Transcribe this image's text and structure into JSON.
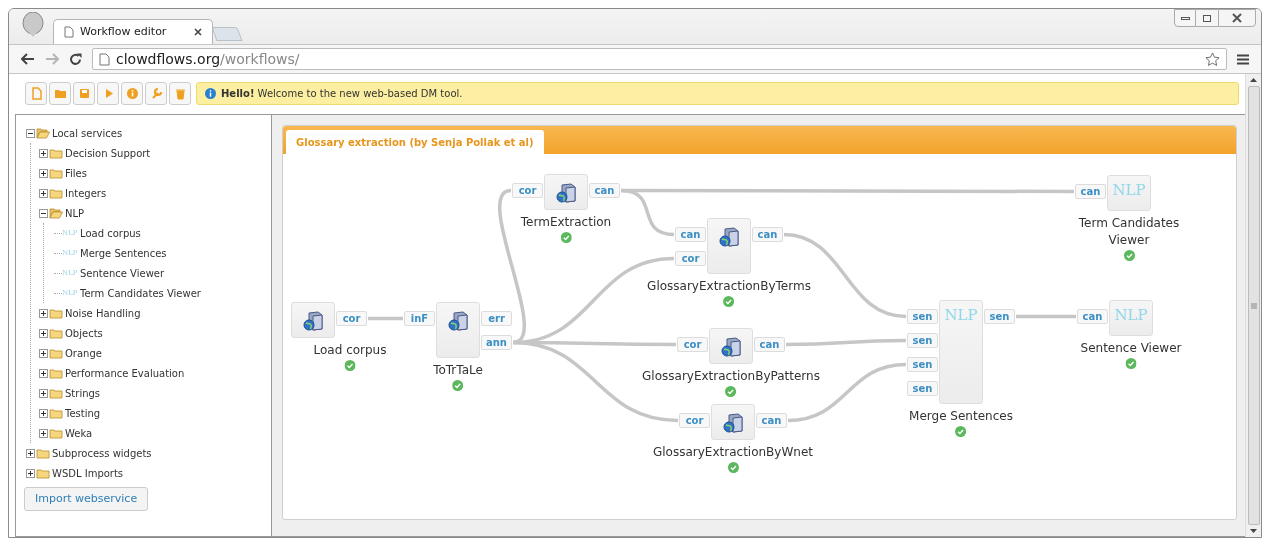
{
  "browser": {
    "tab_title": "Workflow editor",
    "url_host": "clowdflows.org",
    "url_path": "/workflows/"
  },
  "toolbar": {
    "buttons": [
      {
        "kind": "new"
      },
      {
        "kind": "open"
      },
      {
        "kind": "save"
      },
      {
        "kind": "run"
      },
      {
        "kind": "info"
      },
      {
        "kind": "settings"
      },
      {
        "kind": "delete"
      }
    ]
  },
  "alert": {
    "text": "**Hello!** Welcome to the new web-based DM tool."
  },
  "sidebar": {
    "tree": [
      {
        "label": "Local services",
        "kind": "category",
        "expanded": true,
        "children": [
          {
            "label": "Decision Support",
            "kind": "category",
            "expanded": false
          },
          {
            "label": "Files",
            "kind": "category",
            "expanded": false
          },
          {
            "label": "Integers",
            "kind": "category",
            "expanded": false
          },
          {
            "label": "NLP",
            "kind": "category",
            "expanded": true,
            "children": [
              {
                "label": "Load corpus",
                "kind": "widget",
                "icon_text": "NLP"
              },
              {
                "label": "Merge Sentences",
                "kind": "widget",
                "icon_text": "NLP"
              },
              {
                "label": "Sentence Viewer",
                "kind": "widget",
                "icon_text": "NLP"
              },
              {
                "label": "Term Candidates Viewer",
                "kind": "widget",
                "icon_text": "NLP"
              }
            ]
          },
          {
            "label": "Noise Handling",
            "kind": "category",
            "expanded": false
          },
          {
            "label": "Objects",
            "kind": "category",
            "expanded": false
          },
          {
            "label": "Orange",
            "kind": "category",
            "expanded": false
          },
          {
            "label": "Performance Evaluation",
            "kind": "category",
            "expanded": false
          },
          {
            "label": "Strings",
            "kind": "category",
            "expanded": false
          },
          {
            "label": "Testing",
            "kind": "category",
            "expanded": false
          },
          {
            "label": "Weka",
            "kind": "category",
            "expanded": false
          }
        ]
      },
      {
        "label": "Subprocess widgets",
        "kind": "category",
        "expanded": false
      },
      {
        "label": "WSDL Imports",
        "kind": "category",
        "expanded": false
      }
    ],
    "button": "Import webservice"
  },
  "workflow": {
    "title": "Glossary extraction (by Senja Pollak et al)",
    "widgets": [
      {
        "name": "Load corpus",
        "kind": "service",
        "outputs": [
          "cor"
        ],
        "finished": true
      },
      {
        "name": "ToTrTaLe",
        "kind": "service",
        "inputs": [
          "inF"
        ],
        "outputs": [
          "err",
          "ann"
        ],
        "finished": true
      },
      {
        "name": "TermExtraction",
        "kind": "service",
        "inputs": [
          "cor"
        ],
        "outputs": [
          "can"
        ],
        "finished": true
      },
      {
        "name": "GlossaryExtractionByTerms",
        "kind": "service",
        "inputs": [
          "can",
          "cor"
        ],
        "outputs": [
          "can"
        ],
        "finished": true
      },
      {
        "name": "GlossaryExtractionByPatterns",
        "kind": "service",
        "inputs": [
          "cor"
        ],
        "outputs": [
          "can"
        ],
        "finished": true
      },
      {
        "name": "GlossaryExtractionByWnet",
        "kind": "service",
        "inputs": [
          "cor"
        ],
        "outputs": [
          "can"
        ],
        "finished": true
      },
      {
        "name": "Merge Sentences",
        "kind": "nlp",
        "icon_text": "NLP",
        "inputs": [
          "sen",
          "sen",
          "sen",
          "sen"
        ],
        "outputs": [
          "sen"
        ],
        "finished": true
      },
      {
        "name": "Term Candidates Viewer",
        "kind": "nlp",
        "icon_text": "NLP",
        "inputs": [
          "can"
        ],
        "finished": true
      },
      {
        "name": "Sentence Viewer",
        "kind": "nlp",
        "icon_text": "NLP",
        "inputs": [
          "can"
        ],
        "finished": true
      }
    ]
  }
}
